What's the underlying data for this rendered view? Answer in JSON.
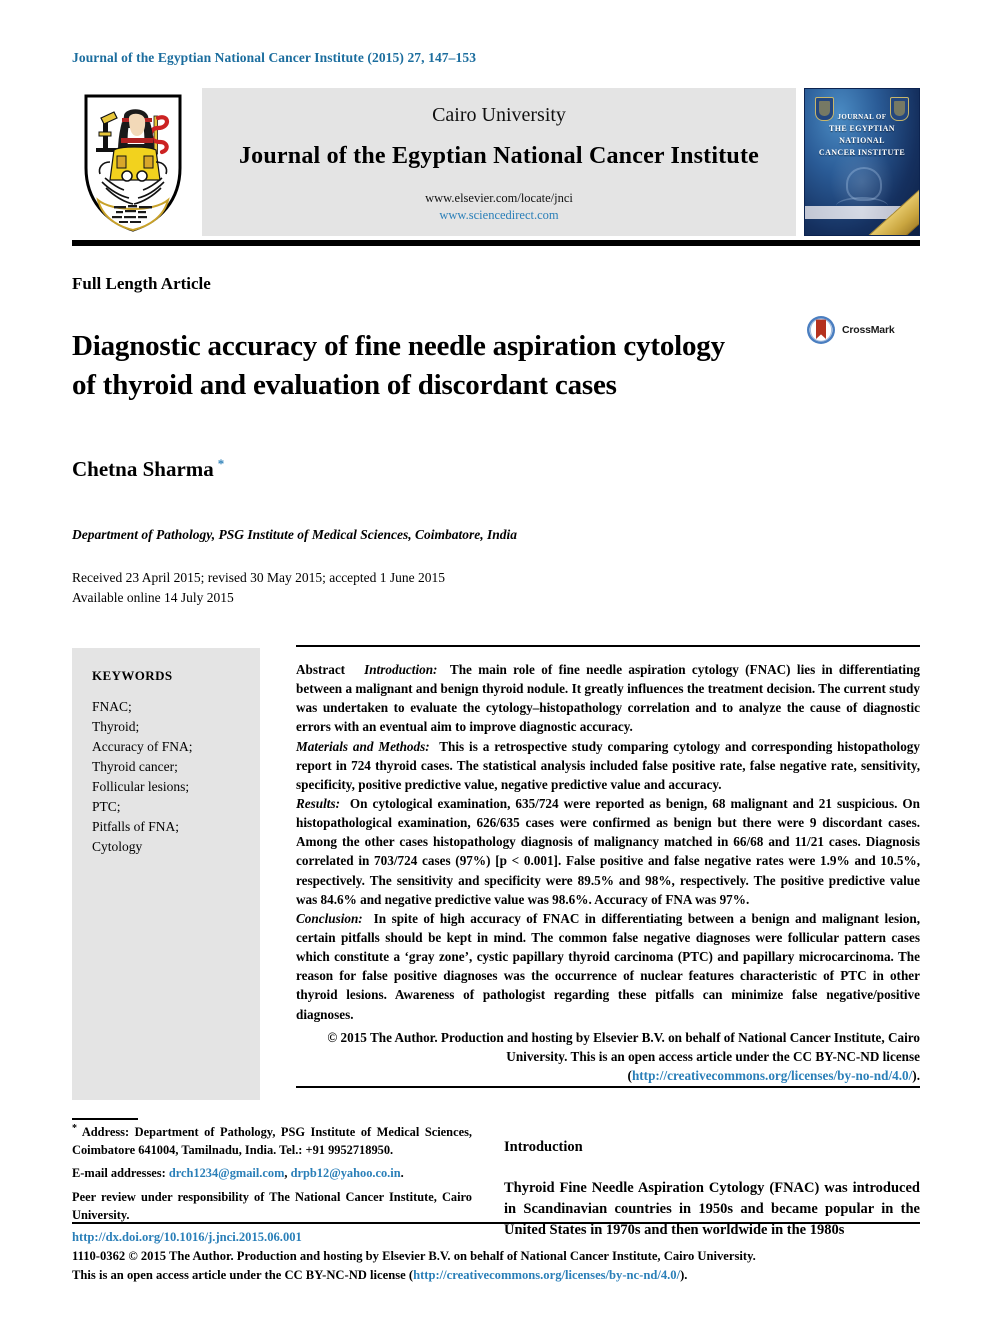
{
  "running_head": "Journal of the Egyptian National Cancer Institute (2015) 27, 147–153",
  "masthead": {
    "logo_alt": "cairo-university-crest",
    "publisher": "Cairo University",
    "journal_title": "Journal of the Egyptian National Cancer Institute",
    "url_elsevier": "www.elsevier.com/locate/jnci",
    "url_sciencedirect": "www.sciencedirect.com",
    "cover": {
      "line1": "Journal of",
      "line2": "The Egyptian National",
      "line3": "Cancer Institute"
    }
  },
  "article": {
    "type": "Full Length Article",
    "title": "Diagnostic accuracy of fine needle aspiration cytology of thyroid and evaluation of discordant cases",
    "crossmark_label": "CrossMark",
    "author": "Chetna Sharma",
    "author_marker": "*",
    "affiliation": "Department of Pathology, PSG Institute of Medical Sciences, Coimbatore, India",
    "received_line": "Received 23 April 2015; revised 30 May 2015; accepted 1 June 2015",
    "available_line": "Available online 14 July 2015"
  },
  "keywords": {
    "heading": "KEYWORDS",
    "items": [
      "FNAC;",
      "Thyroid;",
      "Accuracy of FNA;",
      "Thyroid cancer;",
      "Follicular lesions;",
      "PTC;",
      "Pitfalls of FNA;",
      "Cytology"
    ]
  },
  "abstract": {
    "label": "Abstract",
    "sections": [
      {
        "heading": "Introduction:",
        "text": "The main role of fine needle aspiration cytology (FNAC) lies in differentiating between a malignant and benign thyroid nodule. It greatly influences the treatment decision. The current study was undertaken to evaluate the cytology–histopathology correlation and to analyze the cause of diagnostic errors with an eventual aim to improve diagnostic accuracy."
      },
      {
        "heading": "Materials and Methods:",
        "text": "This is a retrospective study comparing cytology and corresponding histopathology report in 724 thyroid cases. The statistical analysis included false positive rate, false negative rate, sensitivity, specificity, positive predictive value, negative predictive value and accuracy."
      },
      {
        "heading": "Results:",
        "text": "On cytological examination, 635/724 were reported as benign, 68 malignant and 21 suspicious. On histopathological examination, 626/635 cases were confirmed as benign but there were 9 discordant cases. Among the other cases histopathology diagnosis of malignancy matched in 66/68 and 11/21 cases. Diagnosis correlated in 703/724 cases (97%) [p < 0.001]. False positive and false negative rates were 1.9% and 10.5%, respectively. The sensitivity and specificity were 89.5% and 98%, respectively. The positive predictive value was 84.6% and negative predictive value was 98.6%. Accuracy of FNA was 97%."
      },
      {
        "heading": "Conclusion:",
        "text": "In spite of high accuracy of FNAC in differentiating between a benign and malignant lesion, certain pitfalls should be kept in mind. The common false negative diagnoses were follicular pattern cases which constitute a ‘gray zone’, cystic papillary thyroid carcinoma (PTC) and papillary microcarcinoma. The reason for false positive diagnoses was the occurrence of nuclear features characteristic of PTC in other thyroid lesions. Awareness of pathologist regarding these pitfalls can minimize false negative/positive diagnoses."
      }
    ],
    "copyright_text": "© 2015 The Author. Production and hosting by Elsevier B.V. on behalf of National Cancer Institute, Cairo University. This is an open access article under the CC BY-NC-ND license (",
    "copyright_link": "http://creativecommons.org/licenses/by-no-nd/4.0/",
    "copyright_tail": ")."
  },
  "footnote": {
    "marker": "*",
    "address": "Address: Department of Pathology, PSG Institute of Medical Sciences, Coimbatore 641004, Tamilnadu, India. Tel.: +91 9952718950.",
    "email_label": "E-mail addresses:",
    "email_1": "drch1234@gmail.com",
    "email_sep": ", ",
    "email_2": "drpb12@yahoo.co.in",
    "email_tail": ".",
    "peer_review": "Peer review under responsibility of The National Cancer Institute, Cairo University."
  },
  "introduction": {
    "heading": "Introduction",
    "body": "Thyroid Fine Needle Aspiration Cytology (FNAC) was introduced in Scandinavian countries in 1950s and became popular in the United States in 1970s and then worldwide in the 1980s"
  },
  "footer": {
    "doi": "http://dx.doi.org/10.1016/j.jnci.2015.06.001",
    "line1": "1110-0362 © 2015 The Author. Production and hosting by Elsevier B.V. on behalf of National Cancer Institute, Cairo University.",
    "line2_pre": "This is an open access article under the CC BY-NC-ND license (",
    "line2_link": "http://creativecommons.org/licenses/by-nc-nd/4.0/",
    "line2_post": ")."
  },
  "colors": {
    "link_blue": "#2a7fb8",
    "masthead_gray": "#e4e4e4",
    "crossmark_blue": "#3a6fb0",
    "crossmark_red": "#b5321f"
  }
}
